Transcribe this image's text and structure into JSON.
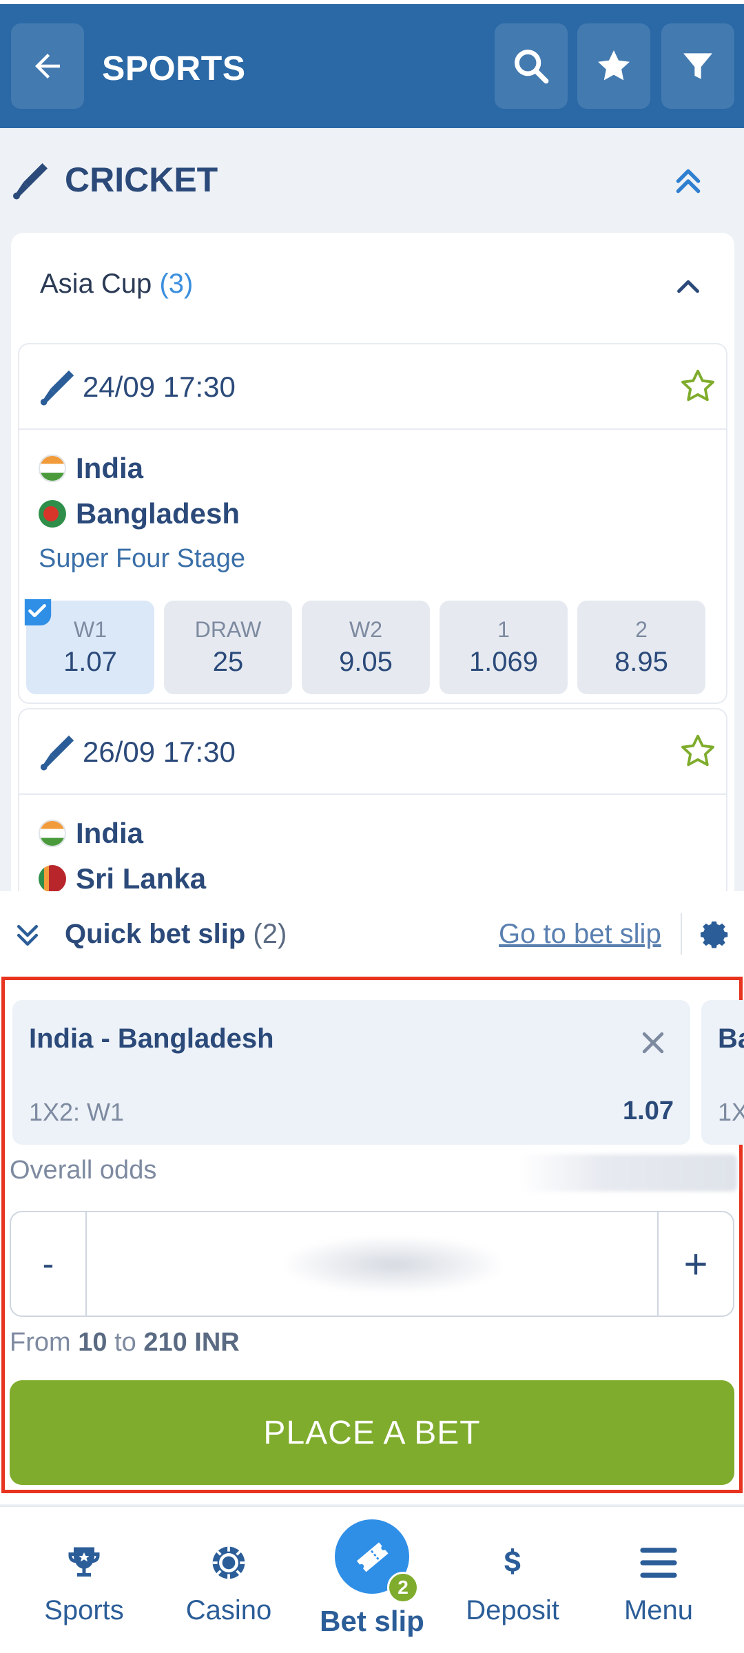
{
  "header": {
    "title": "SPORTS",
    "icons": [
      "back-arrow-icon",
      "search-icon",
      "star-icon",
      "filter-icon"
    ]
  },
  "section": {
    "title": "CRICKET",
    "icon": "cricket-bat-icon"
  },
  "group": {
    "name": "Asia Cup",
    "count": "(3)"
  },
  "matches": [
    {
      "datetime": "24/09 17:30",
      "team1": "India",
      "team2": "Bangladesh",
      "stage": "Super Four Stage",
      "odds": [
        {
          "label": "W1",
          "value": "1.07",
          "selected": true
        },
        {
          "label": "DRAW",
          "value": "25"
        },
        {
          "label": "W2",
          "value": "9.05"
        },
        {
          "label": "1",
          "value": "1.069"
        },
        {
          "label": "2",
          "value": "8.95"
        }
      ]
    },
    {
      "datetime": "26/09 17:30",
      "team1": "India",
      "team2": "Sri Lanka"
    }
  ],
  "bet_slip": {
    "title": "Quick bet slip",
    "count": "(2)",
    "go_to": "Go to bet slip",
    "selection": {
      "event": "India - Bangladesh",
      "market": "1X2: W1",
      "odd": "1.07",
      "next_event_peek": "Ba",
      "next_market_peek": "1X"
    },
    "overall_odds_label": "Overall odds",
    "minus": "-",
    "plus": "+",
    "range_prefix": "From",
    "range_min": "10",
    "range_to": "to",
    "range_max": "210 INR",
    "place_bet": "PLACE A BET"
  },
  "bottom_nav": {
    "items": [
      "Sports",
      "Casino",
      "Bet slip",
      "Deposit",
      "Menu"
    ],
    "betslip_badge": "2"
  },
  "colors": {
    "header_blue": "#2a68a6",
    "accent_green": "#7fac2c",
    "link_blue": "#3b8fde",
    "highlight_red": "#e8331f"
  }
}
